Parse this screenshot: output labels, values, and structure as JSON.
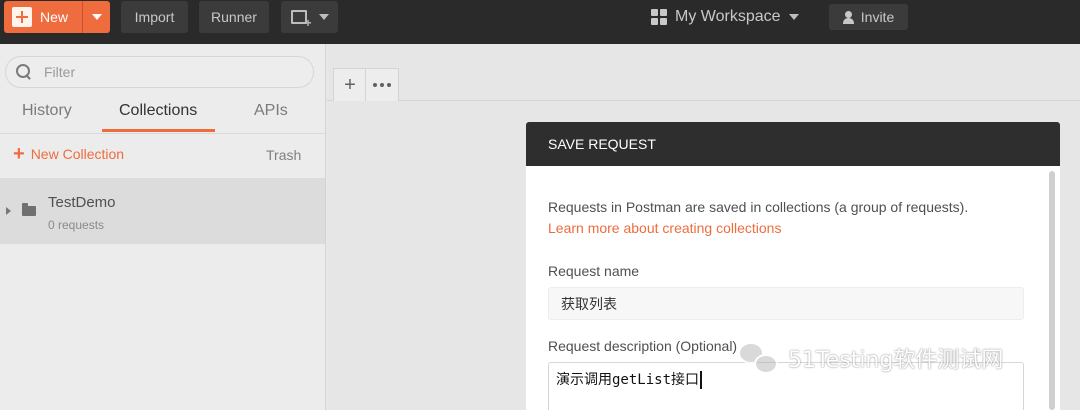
{
  "topbar": {
    "new_label": "New",
    "import_label": "Import",
    "runner_label": "Runner",
    "workspace_label": "My Workspace",
    "invite_label": "Invite"
  },
  "sidebar": {
    "filter_placeholder": "Filter",
    "tabs": [
      {
        "label": "History"
      },
      {
        "label": "Collections"
      },
      {
        "label": "APIs"
      }
    ],
    "new_collection_label": "New Collection",
    "trash_label": "Trash",
    "collections": [
      {
        "name": "TestDemo",
        "count": "0 requests"
      }
    ]
  },
  "modal": {
    "title": "SAVE REQUEST",
    "info_text": "Requests in Postman are saved in collections (a group of requests).",
    "learn_more_link": "Learn more about creating collections",
    "request_name_label": "Request name",
    "request_name_value": "获取列表",
    "description_label": "Request description (Optional)",
    "description_value": "演示调用getList接口"
  },
  "watermark": {
    "text": "51Testing软件测试网"
  },
  "colors": {
    "accent": "#ef6c3f",
    "topbar": "#2a2a2a",
    "modal_header": "#2e2e2e"
  }
}
